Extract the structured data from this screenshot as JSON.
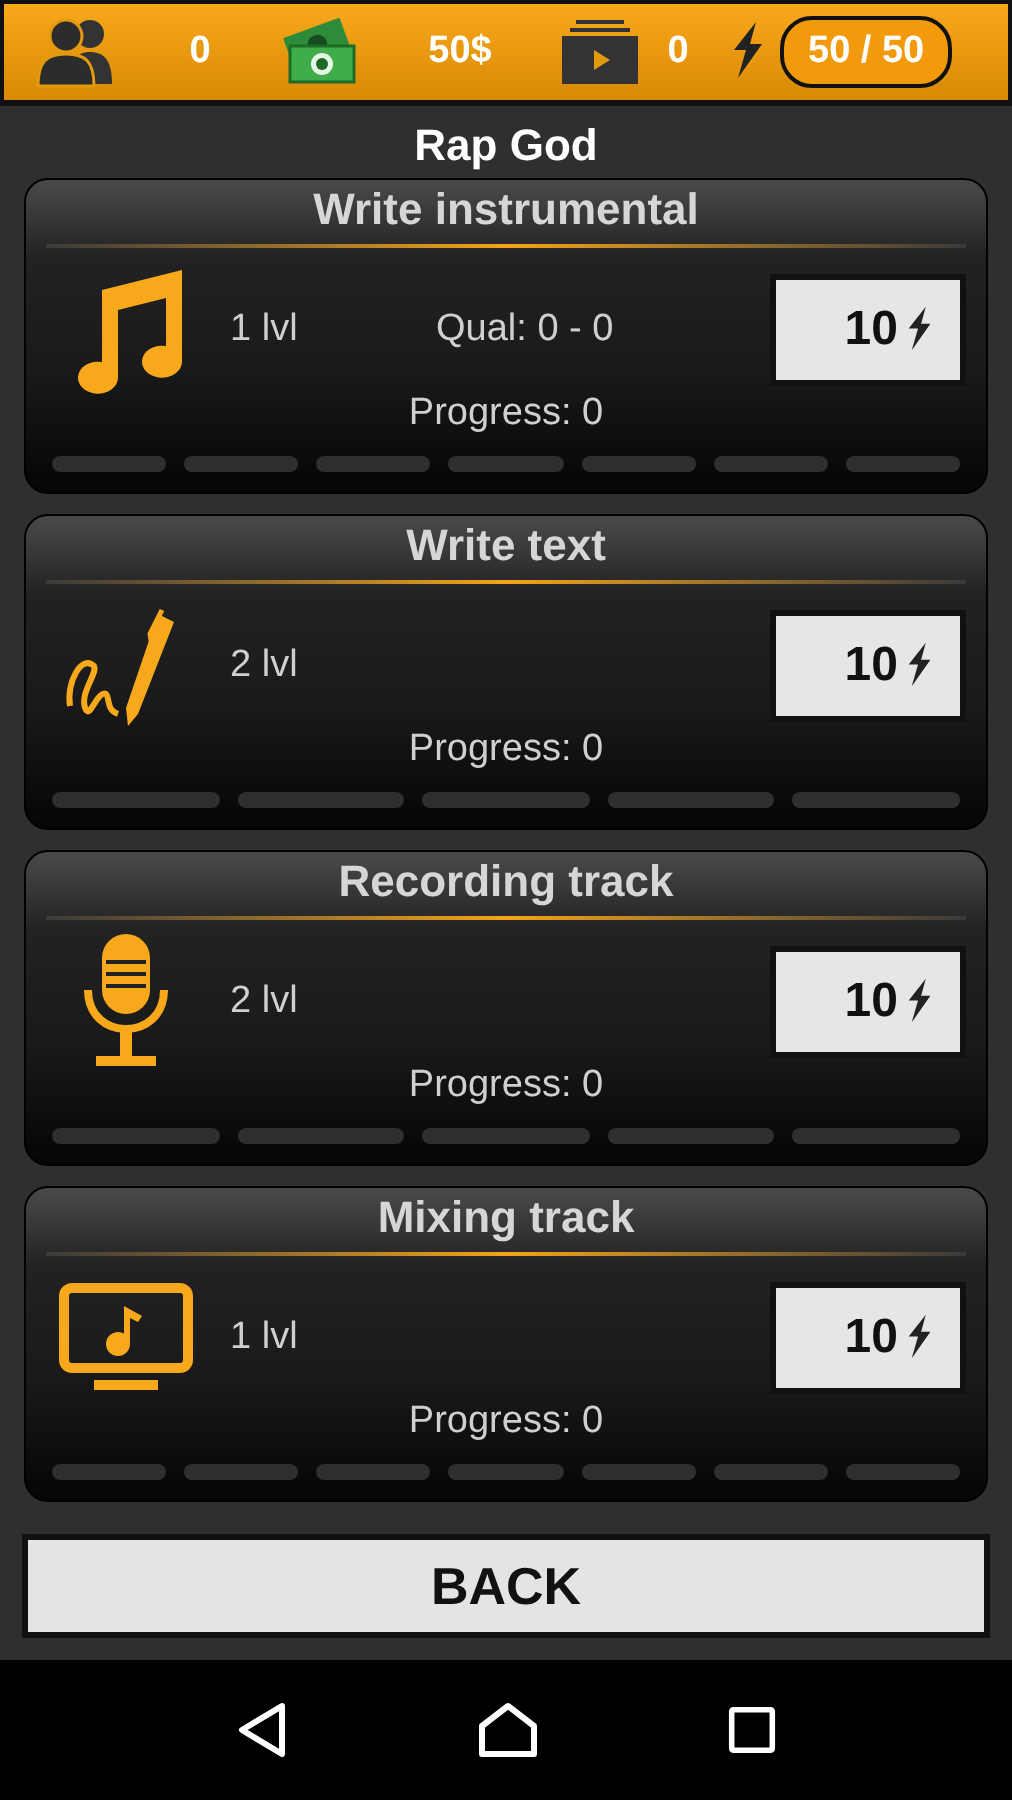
{
  "top_bar": {
    "fans": "0",
    "money": "50$",
    "videos": "0",
    "energy": "50 / 50"
  },
  "title": "Rap God",
  "tasks": [
    {
      "title": "Write instrumental",
      "kind": "note",
      "level": "1 lvl",
      "quality": "Qual: 0 - 0",
      "progress": "Progress: 0",
      "cost": "10",
      "steps": [
        {
          "filled": false
        },
        {
          "filled": false
        },
        {
          "filled": false
        },
        {
          "filled": false
        },
        {
          "filled": false
        },
        {
          "filled": false
        },
        {
          "filled": false
        }
      ]
    },
    {
      "title": "Write text",
      "kind": "pen",
      "level": "2 lvl",
      "progress": "Progress: 0",
      "cost": "10",
      "steps": [
        {
          "filled": false
        },
        {
          "filled": false
        },
        {
          "filled": false
        },
        {
          "filled": false
        },
        {
          "filled": false
        }
      ]
    },
    {
      "title": "Recording track",
      "kind": "mic",
      "level": "2 lvl",
      "progress": "Progress: 0",
      "cost": "10",
      "steps": [
        {
          "filled": false
        },
        {
          "filled": false
        },
        {
          "filled": false
        },
        {
          "filled": false
        },
        {
          "filled": false
        }
      ]
    },
    {
      "title": "Mixing track",
      "kind": "monitor",
      "level": "1 lvl",
      "progress": "Progress: 0",
      "cost": "10",
      "steps": [
        {
          "filled": false
        },
        {
          "filled": false
        },
        {
          "filled": false
        },
        {
          "filled": false
        },
        {
          "filled": false
        },
        {
          "filled": false
        },
        {
          "filled": false
        }
      ]
    }
  ],
  "back_button": "BACK"
}
